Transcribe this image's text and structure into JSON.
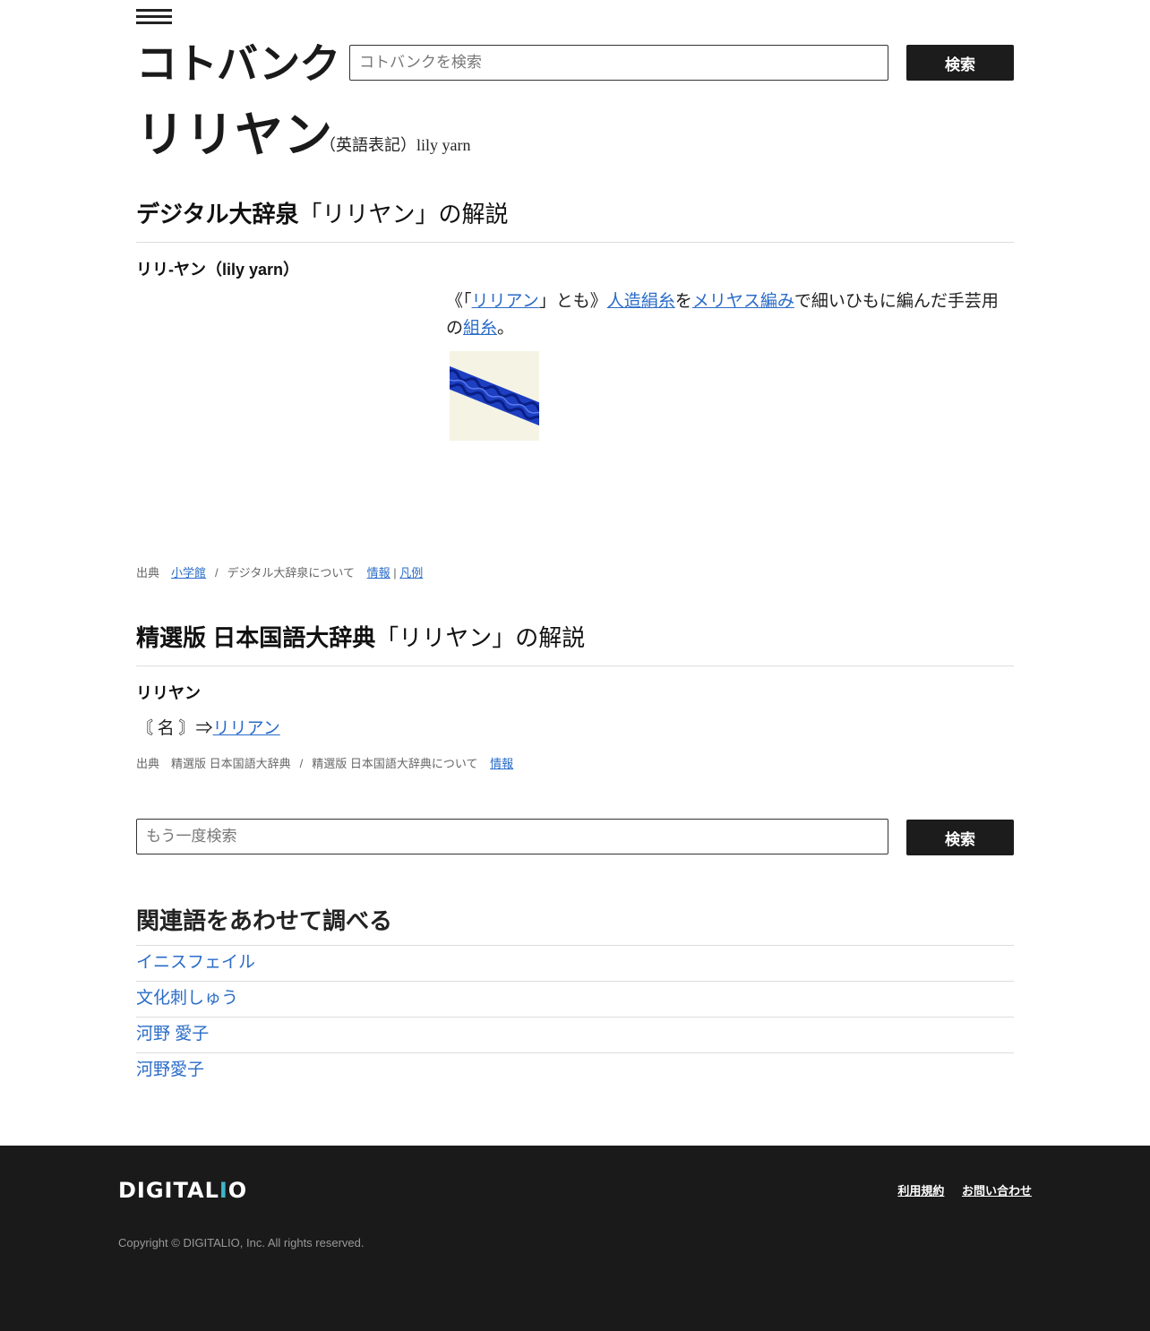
{
  "header": {
    "logo": "コトバンク",
    "search_placeholder": "コトバンクを検索",
    "search_button": "検索"
  },
  "title": {
    "word": "リリヤン",
    "english": "（英語表記）lily yarn"
  },
  "section1": {
    "dict_name": "デジタル大辞泉",
    "heading_rest": "「リリヤン」の解説",
    "entry_head": "リリ-ヤン（lily yarn）",
    "desc": {
      "t1": "《「",
      "l1": "リリアン",
      "t2": "」とも》",
      "l2": "人造絹糸",
      "t3": "を",
      "l3": "メリヤス編み",
      "t4": "で細いひもに編んだ手芸用の",
      "l4": "組糸",
      "t5": "。"
    },
    "source": {
      "label": "出典",
      "publisher": "小学館",
      "sep": "/",
      "about": "デジタル大辞泉について",
      "info": "情報",
      "pipe": "|",
      "legend": "凡例"
    }
  },
  "section2": {
    "dict_name": "精選版 日本国語大辞典",
    "heading_rest": "「リリヤン」の解説",
    "entry_head": "リリヤン",
    "pos": "〘 名 〙",
    "arrow": "⇒",
    "link": "リリアン",
    "source": {
      "label": "出典",
      "publisher": "精選版 日本国語大辞典",
      "sep": "/",
      "about": "精選版 日本国語大辞典について",
      "info": "情報"
    }
  },
  "search_again": {
    "placeholder": "もう一度検索",
    "button": "検索"
  },
  "related": {
    "title": "関連語をあわせて調べる",
    "items": [
      "イニスフェイル",
      "文化刺しゅう",
      "河野 愛子",
      "河野愛子"
    ]
  },
  "footer": {
    "logo_a": "DIGITAL",
    "logo_b": "I",
    "logo_c": "O",
    "terms": "利用規約",
    "contact": "お問い合わせ",
    "copyright": "Copyright © DIGITALIO, Inc. All rights reserved."
  },
  "colors": {
    "link": "#2a6cc8",
    "button_bg": "#1c1c1c",
    "footer_bg": "#1a1a1a",
    "footer_accent": "#3db6c9"
  }
}
